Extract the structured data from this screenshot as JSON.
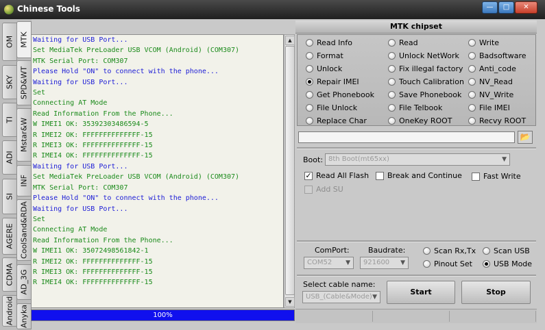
{
  "window": {
    "title": "Chinese Tools"
  },
  "tabs": {
    "outer": [
      "OM",
      "SKY",
      "TI",
      "ADI",
      "SI",
      "AGERE",
      "CDMA",
      "Android"
    ],
    "inner": [
      "MTK",
      "SPD&WT",
      "Mstar&W",
      "INF",
      "CoolSand&RDA",
      "AD_3G",
      "Anyka"
    ]
  },
  "log": {
    "lines": [
      {
        "text": "Waiting for USB Port...",
        "color": "#1b1bd6"
      },
      {
        "text": "Set MediaTek PreLoader USB VCOM (Android) (COM307)",
        "color": "#1a8a1a"
      },
      {
        "text": "MTK Serial Port: COM307",
        "color": "#1a8a1a"
      },
      {
        "text": "Please Hold \"ON\" to connect with the phone...",
        "color": "#1b1bd6"
      },
      {
        "text": "Waiting for USB Port...",
        "color": "#1b1bd6"
      },
      {
        "text": "Set",
        "color": "#1a8a1a"
      },
      {
        "text": "Connecting AT Mode",
        "color": "#1a8a1a"
      },
      {
        "text": "Read Information From the Phone...",
        "color": "#1a8a1a"
      },
      {
        "text": "W IMEI1 OK: 35392303486594-5",
        "color": "#1a8a1a"
      },
      {
        "text": "R IMEI2 OK: FFFFFFFFFFFFFF-15",
        "color": "#1a8a1a"
      },
      {
        "text": "R IMEI3 OK: FFFFFFFFFFFFFF-15",
        "color": "#1a8a1a"
      },
      {
        "text": "R IMEI4 OK: FFFFFFFFFFFFFF-15",
        "color": "#1a8a1a"
      },
      {
        "text": "Waiting for USB Port...",
        "color": "#1b1bd6"
      },
      {
        "text": "Set MediaTek PreLoader USB VCOM (Android) (COM307)",
        "color": "#1a8a1a"
      },
      {
        "text": "MTK Serial Port: COM307",
        "color": "#1a8a1a"
      },
      {
        "text": "Please Hold \"ON\" to connect with the phone...",
        "color": "#1b1bd6"
      },
      {
        "text": "Waiting for USB Port...",
        "color": "#1b1bd6"
      },
      {
        "text": "Set",
        "color": "#1a8a1a"
      },
      {
        "text": "Connecting AT Mode",
        "color": "#1a8a1a"
      },
      {
        "text": "Read Information From the Phone...",
        "color": "#1a8a1a"
      },
      {
        "text": "W IMEI1 OK: 35072498561842-1",
        "color": "#1a8a1a"
      },
      {
        "text": "R IMEI2 OK: FFFFFFFFFFFFFF-15",
        "color": "#1a8a1a"
      },
      {
        "text": "R IMEI3 OK: FFFFFFFFFFFFFF-15",
        "color": "#1a8a1a"
      },
      {
        "text": "R IMEI4 OK: FFFFFFFFFFFFFF-15",
        "color": "#1a8a1a"
      }
    ]
  },
  "progress": {
    "label": "100%",
    "value": 1.0
  },
  "panel": {
    "title": "MTK chipset"
  },
  "operations": {
    "selected": "Repair IMEI",
    "columns": [
      [
        "Read Info",
        "Format",
        "Unlock",
        "Repair IMEI",
        "Get Phonebook",
        "File Unlock",
        "Replace Char"
      ],
      [
        "Read",
        "Unlock NetWork",
        "Fix illegal factory",
        "Touch Calibration",
        "Save Phonebook",
        "File Telbook",
        "OneKey ROOT"
      ],
      [
        "Write",
        "Badsoftware",
        "Anti_code",
        "NV_Read",
        "NV_Write",
        "File IMEI",
        "Recvy ROOT"
      ]
    ]
  },
  "file": {
    "path": ""
  },
  "boot": {
    "label": "Boot:",
    "value": "8th Boot(mt65xx)"
  },
  "options": {
    "read_all_flash": {
      "label": "Read All Flash",
      "checked": true
    },
    "break_continue": {
      "label": "Break and Continue",
      "checked": false
    },
    "fast_write": {
      "label": "Fast Write",
      "checked": false
    },
    "add_su": {
      "label": "Add SU",
      "checked": false
    }
  },
  "port": {
    "comport_label": "ComPort:",
    "comport_value": "COM52",
    "baudrate_label": "Baudrate:",
    "baudrate_value": "921600"
  },
  "scan": {
    "scan_rxtx": "Scan Rx,Tx",
    "scan_usb": "Scan USB",
    "pinout_set": "Pinout Set",
    "usb_mode": "USB Mode",
    "selected": "USB Mode"
  },
  "cable": {
    "label": "Select cable name:",
    "value": "USB_(Cable&Mode)"
  },
  "actions": {
    "start": "Start",
    "stop": "Stop"
  }
}
